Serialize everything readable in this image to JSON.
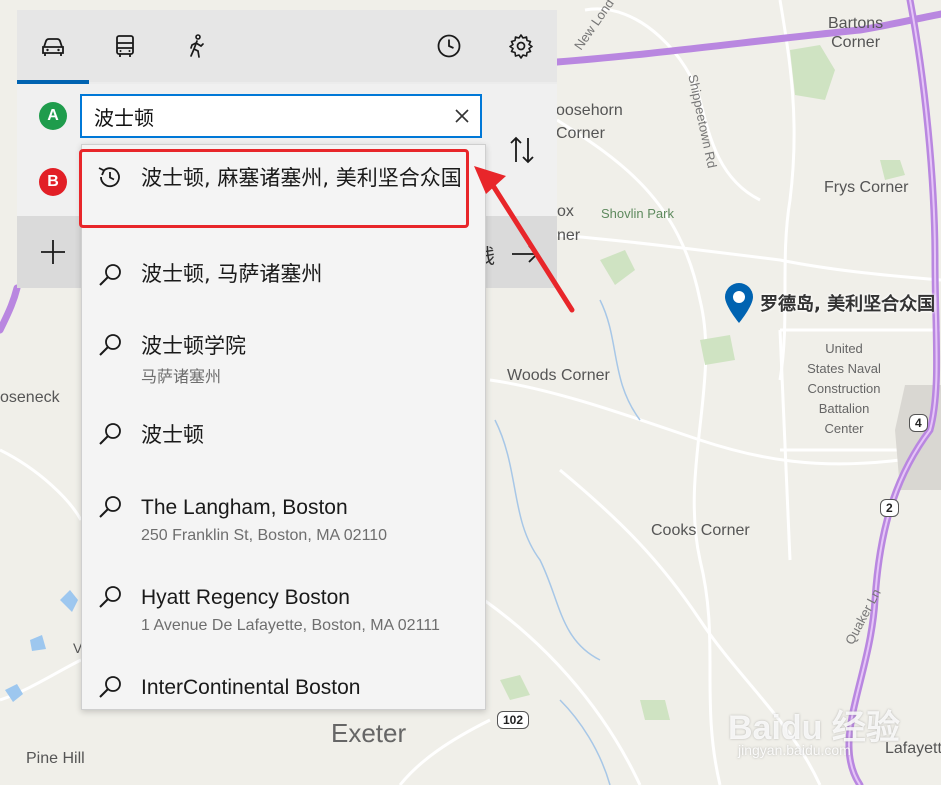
{
  "colors": {
    "accent": "#0063b1",
    "waypoint_a": "#1f9c4c",
    "waypoint_b": "#e21f26",
    "highlight": "#e8262a",
    "road_major": "#b987e0"
  },
  "mode_tabs": [
    {
      "icon": "car-icon",
      "active": true
    },
    {
      "icon": "bus-icon",
      "active": false
    },
    {
      "icon": "walk-icon",
      "active": false
    }
  ],
  "header_icons": [
    "clock-icon",
    "gear-icon"
  ],
  "waypoints": {
    "a_label": "A",
    "b_label": "B"
  },
  "search": {
    "value": "波士顿"
  },
  "add_row": {
    "go_text": "线"
  },
  "suggestions": [
    {
      "icon": "history-icon",
      "title": "波士顿, 麻塞诸塞州, 美利坚合众国",
      "subtitle": ""
    },
    {
      "icon": "search-icon",
      "title": "波士顿, 马萨诸塞州",
      "subtitle": ""
    },
    {
      "icon": "search-icon",
      "title": "波士顿学院",
      "subtitle": "马萨诸塞州"
    },
    {
      "icon": "search-icon",
      "title": "波士顿",
      "subtitle": ""
    },
    {
      "icon": "search-icon",
      "title": "The Langham, Boston",
      "subtitle": "250 Franklin St, Boston, MA 02110"
    },
    {
      "icon": "search-icon",
      "title": "Hyatt Regency Boston",
      "subtitle": "1 Avenue De Lafayette, Boston, MA 02111"
    },
    {
      "icon": "search-icon",
      "title": "InterContinental Boston",
      "subtitle": ""
    }
  ],
  "map": {
    "pin_label": "罗德岛, 美利坚合众国",
    "labels": {
      "bartons": "Bartons\nCorner",
      "goosehorn": "oosehorn\nCorner",
      "frys": "Frys Corner",
      "shovlin": "Shovlin Park",
      "fox": "ox",
      "ner": "ner",
      "woods": "Woods Corner",
      "oseneck": "oseneck",
      "cooks": "Cooks Corner",
      "exeter": "Exeter",
      "pinehill": "Pine Hill",
      "lafayette": "Lafayett",
      "naval": "United\nStates Naval\nConstruction\nBattalion\nCenter",
      "newlondon": "New Lond",
      "shippee": "Shippeetown Rd",
      "quaker": "Quaker Ln",
      "v": "V"
    },
    "shields": {
      "r4": "4",
      "r2": "2",
      "r102": "102"
    }
  },
  "watermark": {
    "brand": "Baidu 经验",
    "url": "jingyan.baidu.com"
  }
}
